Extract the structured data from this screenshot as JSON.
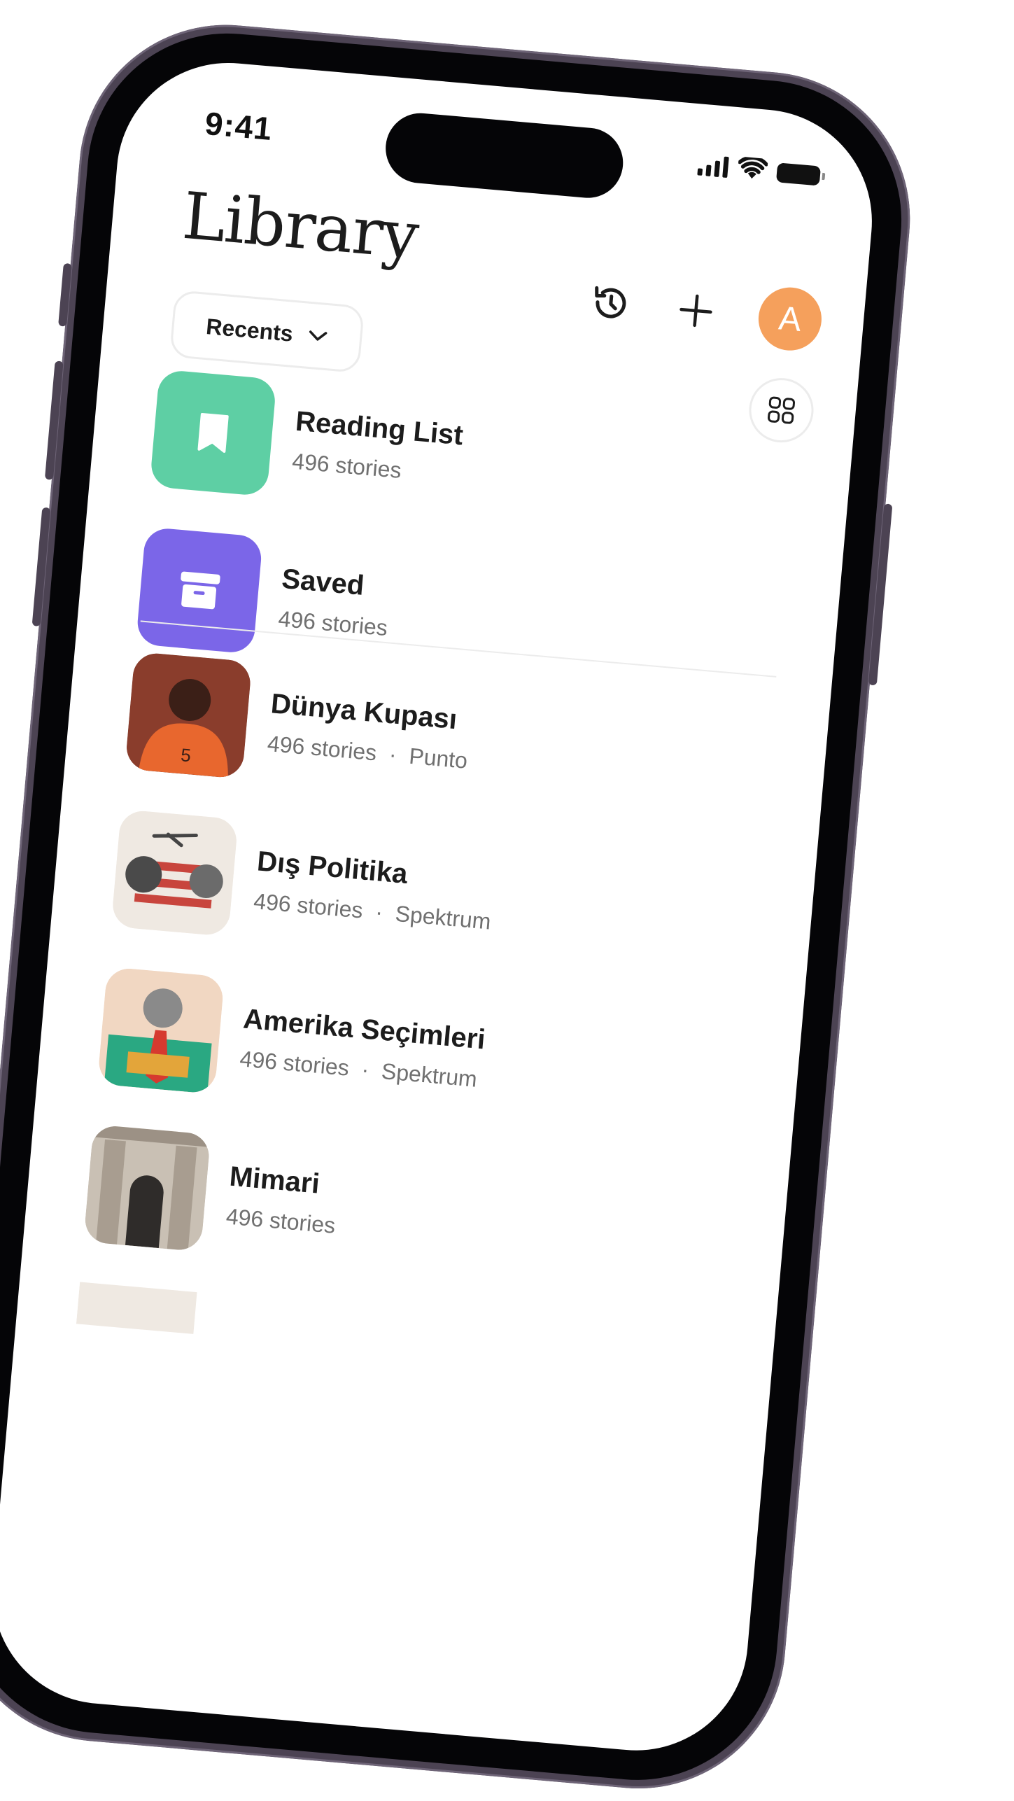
{
  "status_bar": {
    "time": "9:41"
  },
  "header": {
    "title": "Library",
    "avatar_initial": "A",
    "avatar_color": "#F5A05C"
  },
  "filter": {
    "selected": "Recents"
  },
  "collections": [
    {
      "title": "Reading List",
      "meta": "496 stories",
      "icon": "bookmark-icon",
      "color": "#5ECFA4"
    },
    {
      "title": "Saved",
      "meta": "496 stories",
      "icon": "archive-box-icon",
      "color": "#7B66E8"
    }
  ],
  "topics": [
    {
      "title": "Dünya Kupası",
      "count": "496 stories",
      "source": "Punto",
      "image": "football-player-image"
    },
    {
      "title": "Dış Politika",
      "count": "496 stories",
      "source": "Spektrum",
      "image": "foreign-policy-collage-image"
    },
    {
      "title": "Amerika Seçimleri",
      "count": "496 stories",
      "source": "Spektrum",
      "image": "us-elections-collage-image"
    },
    {
      "title": "Mimari",
      "count": "496 stories",
      "source": "",
      "image": "architecture-photo-image"
    }
  ]
}
